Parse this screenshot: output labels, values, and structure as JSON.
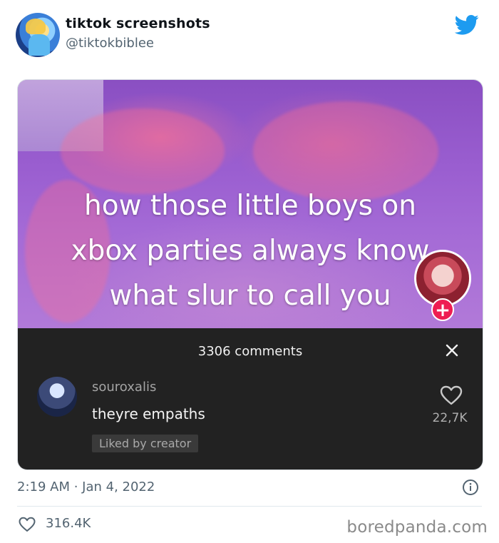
{
  "tweet": {
    "display_name": "tiktok screenshots",
    "handle": "@tiktokbiblee",
    "timestamp": "2:19 AM · Jan 4, 2022",
    "likes": "316.4K",
    "brand_color": "#1d9bf0"
  },
  "video": {
    "caption_lines": [
      "how those little boys on",
      "xbox parties always know",
      "what slur to call you"
    ],
    "follow_label": "+"
  },
  "comments": {
    "count_label": "3306 comments",
    "close_label": "×",
    "items": [
      {
        "username": "souroxalis",
        "text": "theyre empaths",
        "badge": "Liked by creator",
        "likes": "22,7K"
      }
    ]
  },
  "icons": {
    "twitter": "twitter-bird-icon",
    "close": "close-icon",
    "heart": "heart-icon",
    "info": "info-icon"
  },
  "watermark": "boredpanda.com"
}
